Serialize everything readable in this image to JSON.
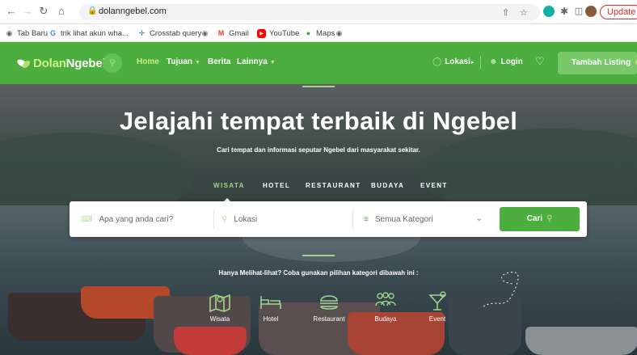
{
  "browser": {
    "url": "dolanngebel.com",
    "update_label": "Update",
    "bookmarks": [
      {
        "label": "Tab Baru",
        "icon": "globe-icon"
      },
      {
        "label": "trik lihat akun wha...",
        "icon": "google-icon"
      },
      {
        "label": "Crosstab query",
        "icon": "tableau-icon"
      },
      {
        "label": "",
        "icon": "globe-icon"
      },
      {
        "label": "Gmail",
        "icon": "gmail-icon"
      },
      {
        "label": "YouTube",
        "icon": "youtube-icon"
      },
      {
        "label": "Maps",
        "icon": "maps-icon"
      },
      {
        "label": "",
        "icon": "globe-icon"
      }
    ]
  },
  "header": {
    "logo_part1": "Dolan",
    "logo_part2": "Ngebel.",
    "nav": [
      {
        "label": "Home",
        "active": true,
        "dropdown": false
      },
      {
        "label": "Tujuan",
        "active": false,
        "dropdown": true
      },
      {
        "label": "Berita",
        "active": false,
        "dropdown": false
      },
      {
        "label": "Lainnya",
        "active": false,
        "dropdown": true
      }
    ],
    "lokasi_label": "Lokasi",
    "login_label": "Login",
    "tambah_label": "Tambah Listing"
  },
  "hero": {
    "title": "Jelajahi tempat terbaik di Ngebel",
    "subtitle": "Cari tempat dan informasi seputar Ngebel dari masyarakat sekitar.",
    "tabs": [
      {
        "label": "WISATA",
        "active": true
      },
      {
        "label": "HOTEL",
        "active": false
      },
      {
        "label": "RESTAURANT",
        "active": false
      },
      {
        "label": "BUDAYA",
        "active": false
      },
      {
        "label": "EVENT",
        "active": false
      }
    ],
    "search": {
      "keyword_placeholder": "Apa yang anda cari?",
      "location_placeholder": "Lokasi",
      "category_selected": "Semua Kategori",
      "button_label": "Cari"
    },
    "hint": "Hanya Melihat-lihat? Coba gunakan pilihan kategori dibawah ini :",
    "categories": [
      {
        "label": "Wisata",
        "icon": "map-icon"
      },
      {
        "label": "Hotel",
        "icon": "bed-icon"
      },
      {
        "label": "Restaurant",
        "icon": "burger-icon"
      },
      {
        "label": "Budaya",
        "icon": "people-icon"
      },
      {
        "label": "Event",
        "icon": "cocktail-icon"
      }
    ]
  },
  "colors": {
    "brand_green": "#4cae3f",
    "accent_light_green": "#9fd68c"
  }
}
